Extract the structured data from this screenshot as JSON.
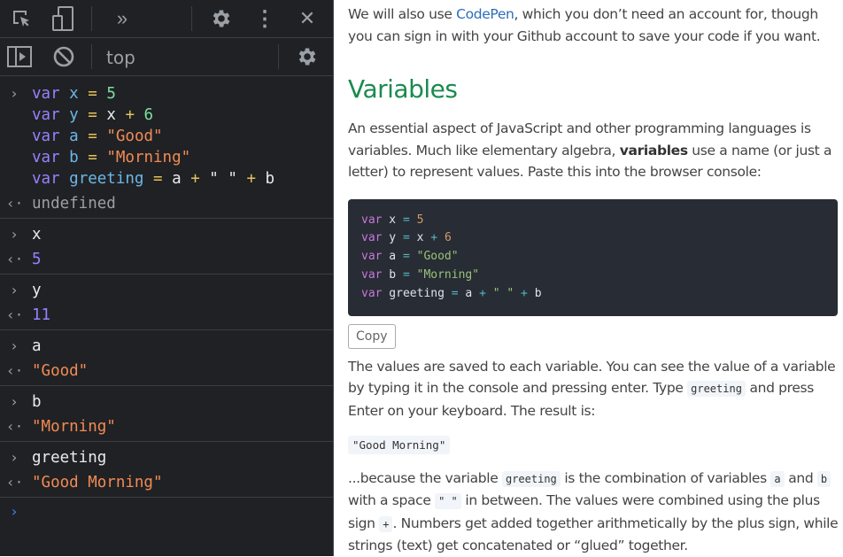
{
  "devtools": {
    "toolbar": {
      "icons": [
        "inspect-element-icon",
        "device-toggle-icon",
        "more-tabs-icon",
        "settings-icon",
        "more-options-icon",
        "close-icon"
      ],
      "more_tabs_glyph": "»",
      "kebab_glyph": "⋮",
      "close_glyph": "✕"
    },
    "console_toolbar": {
      "context": "top",
      "icons": [
        "show-sidebar-icon",
        "clear-console-icon",
        "console-settings-icon"
      ]
    },
    "entries": [
      {
        "input_lines": [
          [
            {
              "t": "var",
              "c": "var"
            },
            {
              "t": " "
            },
            {
              "t": "x",
              "c": "id"
            },
            {
              "t": " "
            },
            {
              "t": "=",
              "c": "op"
            },
            {
              "t": " "
            },
            {
              "t": "5",
              "c": "num"
            }
          ],
          [
            {
              "t": "var",
              "c": "var"
            },
            {
              "t": " "
            },
            {
              "t": "y",
              "c": "id"
            },
            {
              "t": " "
            },
            {
              "t": "=",
              "c": "op"
            },
            {
              "t": " "
            },
            {
              "t": "x",
              "c": "plain"
            },
            {
              "t": " "
            },
            {
              "t": "+",
              "c": "op"
            },
            {
              "t": " "
            },
            {
              "t": "6",
              "c": "num"
            }
          ],
          [
            {
              "t": "var",
              "c": "var"
            },
            {
              "t": " "
            },
            {
              "t": "a",
              "c": "id"
            },
            {
              "t": " "
            },
            {
              "t": "=",
              "c": "op"
            },
            {
              "t": " "
            },
            {
              "t": "\"Good\"",
              "c": "str"
            }
          ],
          [
            {
              "t": "var",
              "c": "var"
            },
            {
              "t": " "
            },
            {
              "t": "b",
              "c": "id"
            },
            {
              "t": " "
            },
            {
              "t": "=",
              "c": "op"
            },
            {
              "t": " "
            },
            {
              "t": "\"Morning\"",
              "c": "str"
            }
          ],
          [
            {
              "t": "var",
              "c": "var"
            },
            {
              "t": " "
            },
            {
              "t": "greeting",
              "c": "id"
            },
            {
              "t": " "
            },
            {
              "t": "=",
              "c": "op"
            },
            {
              "t": " "
            },
            {
              "t": "a",
              "c": "plain"
            },
            {
              "t": " "
            },
            {
              "t": "+",
              "c": "op"
            },
            {
              "t": " "
            },
            {
              "t": "\" \"",
              "c": "plain"
            },
            {
              "t": " "
            },
            {
              "t": "+",
              "c": "op"
            },
            {
              "t": " "
            },
            {
              "t": "b",
              "c": "plain"
            }
          ]
        ],
        "result": "undefined",
        "result_type": "undef"
      },
      {
        "input": "x",
        "result": "5",
        "result_type": "numres"
      },
      {
        "input": "y",
        "result": "11",
        "result_type": "numres"
      },
      {
        "input": "a",
        "result": "\"Good\"",
        "result_type": "str"
      },
      {
        "input": "b",
        "result": "\"Morning\"",
        "result_type": "str"
      },
      {
        "input": "greeting",
        "result": "\"Good Morning\"",
        "result_type": "str"
      }
    ],
    "input_glyph": "›",
    "result_glyph": "‹·"
  },
  "article": {
    "intro": {
      "before_link": "We will also use ",
      "link": "CodePen",
      "after_link": ", which you don’t need an account for, though you can sign in with your Github account to save your code if you want."
    },
    "heading": "Variables",
    "para1": {
      "before_bold": "An essential aspect of JavaScript and other programming languages is variables. Much like elementary algebra, ",
      "bold": "variables",
      "after_bold": " use a name (or just a letter) to represent values. Paste this into the browser console:"
    },
    "code_lines": [
      [
        {
          "t": "var",
          "c": "kw"
        },
        {
          "t": " x "
        },
        {
          "t": "=",
          "c": "op"
        },
        {
          "t": " "
        },
        {
          "t": "5",
          "c": "num"
        }
      ],
      [
        {
          "t": "var",
          "c": "kw"
        },
        {
          "t": " y "
        },
        {
          "t": "=",
          "c": "op"
        },
        {
          "t": " x "
        },
        {
          "t": "+",
          "c": "op"
        },
        {
          "t": " "
        },
        {
          "t": "6",
          "c": "num"
        }
      ],
      [
        {
          "t": "var",
          "c": "kw"
        },
        {
          "t": " a "
        },
        {
          "t": "=",
          "c": "op"
        },
        {
          "t": " "
        },
        {
          "t": "\"Good\"",
          "c": "str"
        }
      ],
      [
        {
          "t": "var",
          "c": "kw"
        },
        {
          "t": " b "
        },
        {
          "t": "=",
          "c": "op"
        },
        {
          "t": " "
        },
        {
          "t": "\"Morning\"",
          "c": "str"
        }
      ],
      [
        {
          "t": "var",
          "c": "kw"
        },
        {
          "t": " greeting "
        },
        {
          "t": "=",
          "c": "op"
        },
        {
          "t": " a "
        },
        {
          "t": "+",
          "c": "op"
        },
        {
          "t": " "
        },
        {
          "t": "\" \"",
          "c": "str"
        },
        {
          "t": " "
        },
        {
          "t": "+",
          "c": "op"
        },
        {
          "t": " b"
        }
      ]
    ],
    "copy_label": "Copy",
    "para2": {
      "before_code": "The values are saved to each variable. You can see the value of a variable by typing it in the console and pressing enter. Type ",
      "code": "greeting",
      "after_code": " and press Enter on your keyboard. The result is:"
    },
    "result_code": "\"Good Morning\"",
    "para3": {
      "t1": "...because the variable ",
      "c1": "greeting",
      "t2": " is the combination of variables ",
      "c2": "a",
      "t3": " and ",
      "c3": "b",
      "t4": " with a space ",
      "c4": "\" \"",
      "t5": " in between. The values were combined using the plus sign ",
      "c5": "+",
      "t6": ". Numbers get added together arithmetically by the plus sign, while strings (text) get concatenated or “glued” together."
    }
  }
}
